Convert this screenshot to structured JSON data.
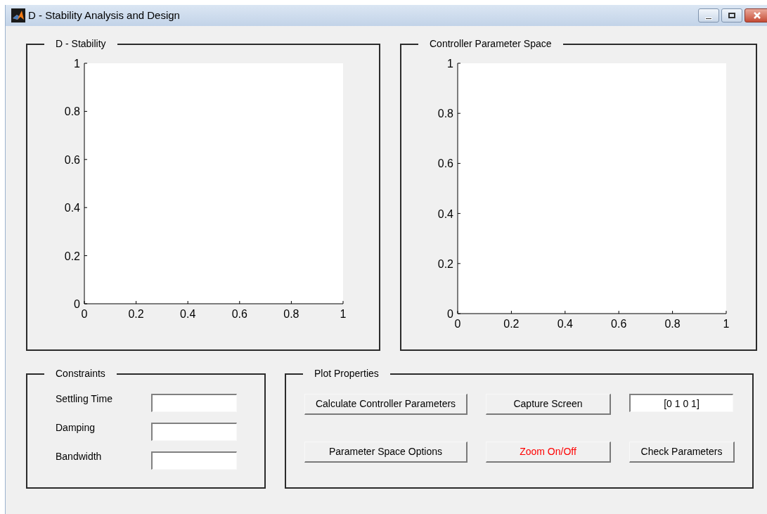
{
  "window": {
    "title": "D - Stability Analysis and Design"
  },
  "panels": [
    {
      "title": "D - Stability",
      "chart_data": {
        "type": "line",
        "xlim": [
          0,
          1
        ],
        "ylim": [
          0,
          1
        ],
        "xticks": [
          0,
          0.2,
          0.4,
          0.6,
          0.8,
          1
        ],
        "yticks": [
          0,
          0.2,
          0.4,
          0.6,
          0.8,
          1
        ]
      }
    },
    {
      "title": "Controller Parameter Space",
      "chart_data": {
        "type": "line",
        "xlim": [
          0,
          1
        ],
        "ylim": [
          0,
          1
        ],
        "xticks": [
          0,
          0.2,
          0.4,
          0.6,
          0.8,
          1
        ],
        "yticks": [
          0,
          0.2,
          0.4,
          0.6,
          0.8,
          1
        ]
      }
    }
  ],
  "constraints": {
    "title": "Constraints",
    "fields": [
      {
        "label": "Settling Time"
      },
      {
        "label": "Damping"
      },
      {
        "label": "Bandwidth"
      }
    ]
  },
  "plot_properties": {
    "title": "Plot Properties",
    "controls": [
      {
        "kind": "button",
        "label": "Calculate Controller Parameters"
      },
      {
        "kind": "button",
        "label": "Capture Screen"
      },
      {
        "kind": "field",
        "value": "[0 1 0 1]"
      },
      {
        "kind": "button",
        "label": "Parameter Space Options"
      },
      {
        "kind": "button",
        "label": "Zoom On/Off",
        "color": "#ff0000"
      },
      {
        "kind": "button",
        "label": "Check Parameters"
      }
    ]
  }
}
